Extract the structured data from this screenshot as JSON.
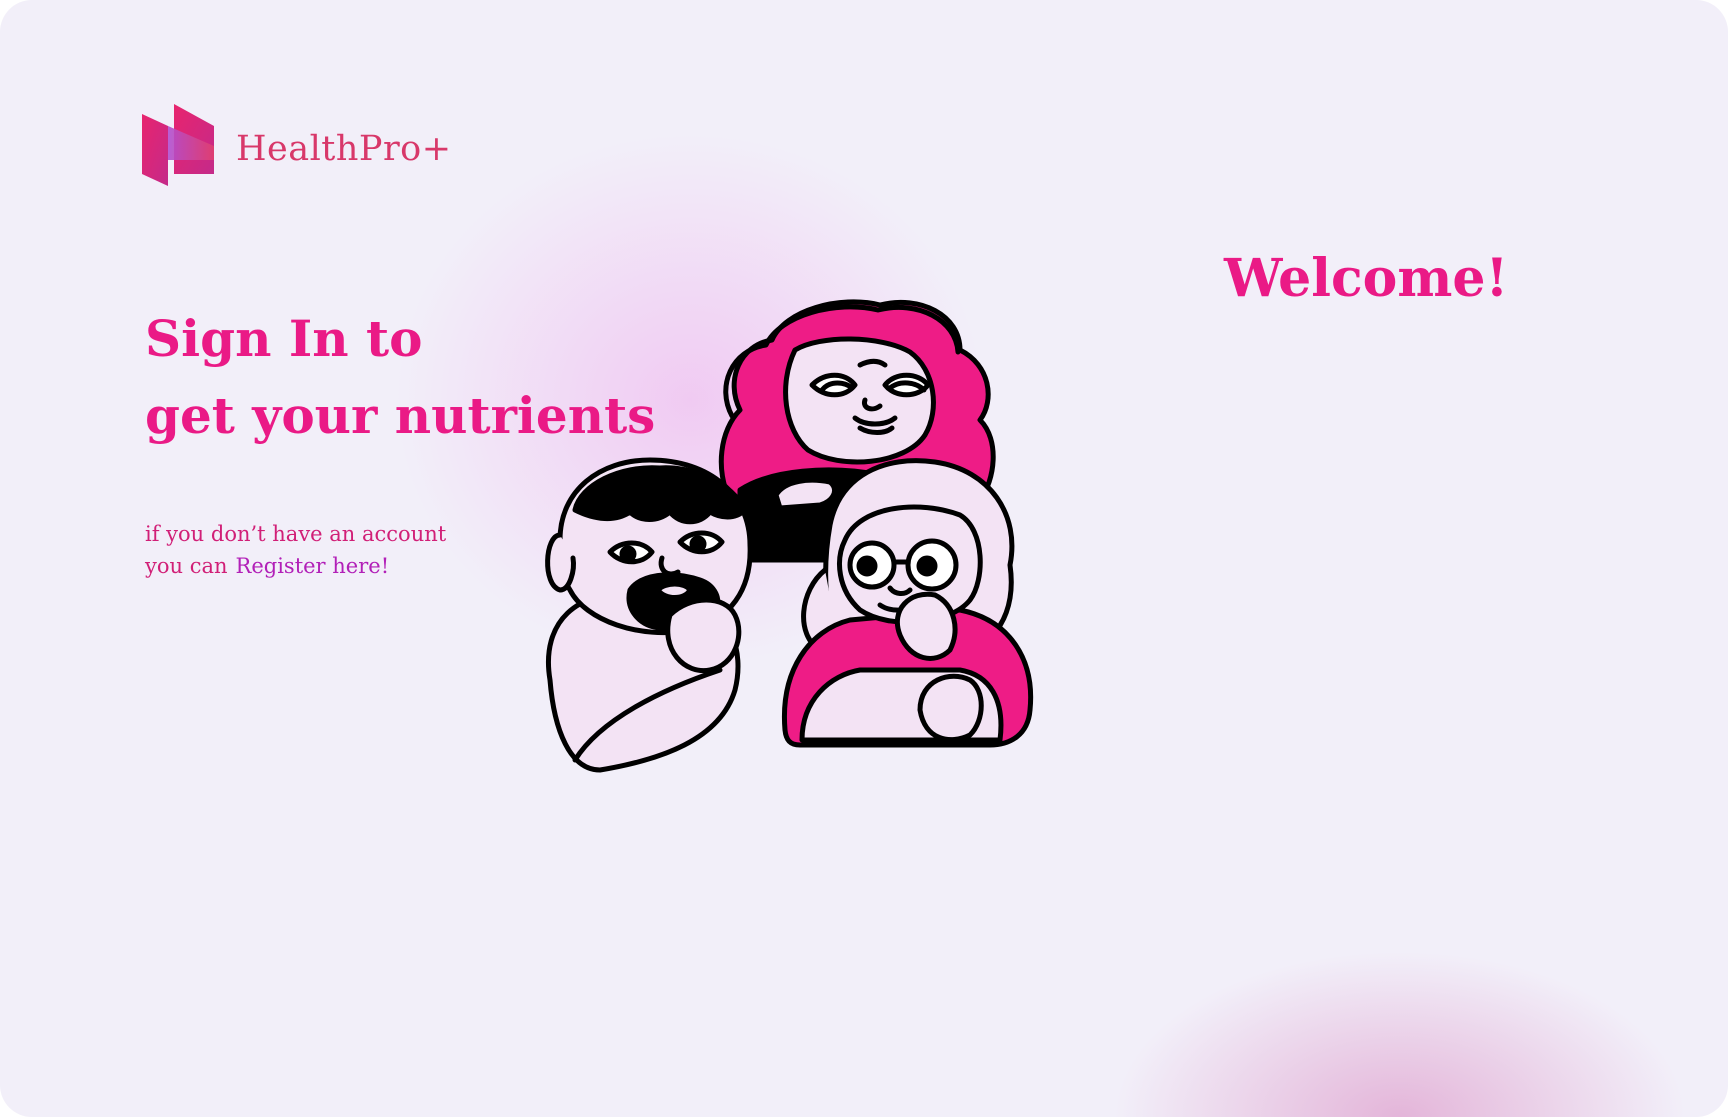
{
  "brand": {
    "name": "HealthPro+",
    "logo_icon": "healthpro-logo-icon"
  },
  "signin": {
    "title_line1": "Sign In to",
    "title_line2": "get your nutrients",
    "register_line1": "if you don’t have an account",
    "register_line2_prefix": "you can",
    "register_link": "Register here!"
  },
  "welcome": {
    "text": "Welcome!"
  },
  "illustration": {
    "icon": "three-people-illustration"
  },
  "colors": {
    "accent": "#ea1a86",
    "brand": "#d8386a",
    "link": "#b220b8",
    "background": "#f2eff9"
  }
}
